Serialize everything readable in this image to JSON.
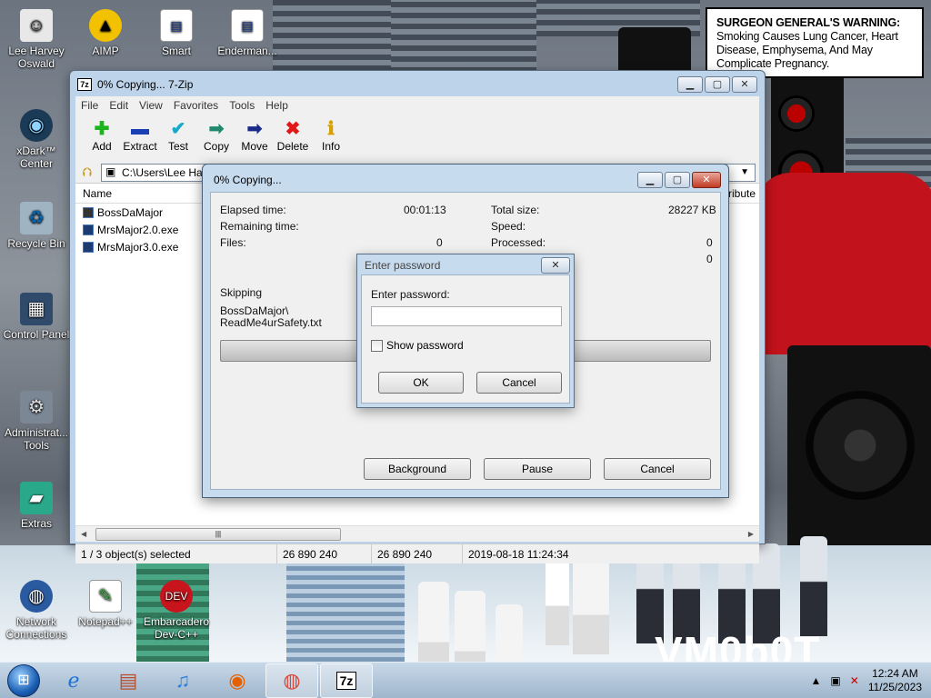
{
  "desktop": {
    "icons": [
      {
        "label": "Lee Harvey Oswald",
        "icon": "person-icon"
      },
      {
        "label": "AIMP",
        "icon": "aimp-icon"
      },
      {
        "label": "Smart",
        "icon": "document-icon"
      },
      {
        "label": "Enderman...",
        "icon": "document-icon"
      },
      {
        "label": "xDark™ Center",
        "icon": "camera-icon"
      },
      {
        "label": "Recycle Bin",
        "icon": "recycle-bin-icon"
      },
      {
        "label": "Control Panel",
        "icon": "control-panel-icon"
      },
      {
        "label": "Administrat... Tools",
        "icon": "gear-icon"
      },
      {
        "label": "Extras",
        "icon": "folder-icon"
      },
      {
        "label": "Network Connections",
        "icon": "network-icon"
      },
      {
        "label": "Notepad++",
        "icon": "notepad-icon"
      },
      {
        "label": "Embarcadero Dev-C++",
        "icon": "devcpp-icon"
      }
    ],
    "warning_bold": "SURGEON GENERAL'S WARNING:",
    "warning_text": "Smoking Causes Lung Cancer, Heart Disease, Emphysema, And May Complicate Pregnancy.",
    "brand_text": "VM0b0T"
  },
  "main_window": {
    "title": "0% Copying... 7-Zip",
    "menu": [
      "File",
      "Edit",
      "View",
      "Favorites",
      "Tools",
      "Help"
    ],
    "toolbar": [
      {
        "label": "Add",
        "icon": "plus-icon",
        "color": "#1db31d"
      },
      {
        "label": "Extract",
        "icon": "minus-icon",
        "color": "#1a3fb5"
      },
      {
        "label": "Test",
        "icon": "check-icon",
        "color": "#18a8c8"
      },
      {
        "label": "Copy",
        "icon": "copy-arrow-icon",
        "color": "#1f8a6d"
      },
      {
        "label": "Move",
        "icon": "move-arrow-icon",
        "color": "#1a2a8a"
      },
      {
        "label": "Delete",
        "icon": "delete-x-icon",
        "color": "#e01818"
      },
      {
        "label": "Info",
        "icon": "info-icon",
        "color": "#d6a000"
      }
    ],
    "address": "C:\\Users\\Lee Ha",
    "column_name": "Name",
    "column_attributes": "ttribute",
    "files": [
      {
        "name": "BossDaMajor",
        "type": "folder"
      },
      {
        "name": "MrsMajor2.0.exe",
        "type": "exe"
      },
      {
        "name": "MrsMajor3.0.exe",
        "type": "exe"
      }
    ],
    "status": {
      "selected": "1 / 3 object(s) selected",
      "size": "26 890 240",
      "packed": "26 890 240",
      "modified": "2019-08-18 11:24:34"
    }
  },
  "copy_dialog": {
    "title": "0% Copying...",
    "elapsed_label": "Elapsed time:",
    "elapsed_value": "00:01:13",
    "remaining_label": "Remaining time:",
    "files_label": "Files:",
    "files_value": "0",
    "total_label": "Total size:",
    "total_value": "28227 KB",
    "speed_label": "Speed:",
    "processed_label": "Processed:",
    "processed_value": "0",
    "extra_value": "0",
    "skipping_label": "Skipping",
    "skipping_path_1": "BossDaMajor\\",
    "skipping_path_2": "ReadMe4urSafety.txt",
    "progress": 0,
    "buttons": {
      "background": "Background",
      "pause": "Pause",
      "cancel": "Cancel"
    }
  },
  "password_dialog": {
    "title": "Enter password",
    "prompt": "Enter password:",
    "value": "",
    "show_password": "Show password",
    "ok": "OK",
    "cancel": "Cancel"
  },
  "taskbar": {
    "apps": [
      "internet-explorer-icon",
      "store-icon",
      "music-icon",
      "firefox-icon",
      "chrome-icon",
      "7zip-icon"
    ],
    "active_app_label": "7z",
    "time": "12:24 AM",
    "date": "11/25/2023"
  }
}
